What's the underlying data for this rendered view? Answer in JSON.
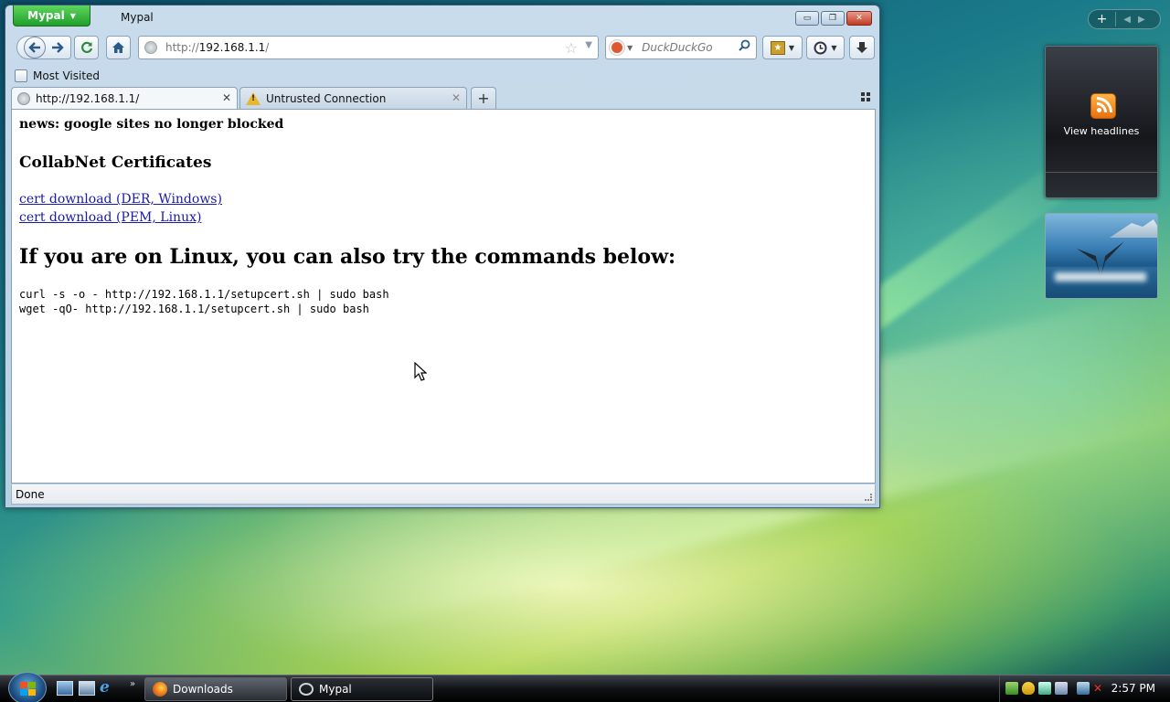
{
  "window": {
    "app_button_label": "Mypal",
    "title": "Mypal",
    "controls": {
      "minimize": "▭",
      "maximize": "❐",
      "close": "✕"
    }
  },
  "navbar": {
    "url_scheme": "http://",
    "url_host": "192.168.1.1",
    "url_path": "/",
    "search_placeholder": "DuckDuckGo"
  },
  "bookmarks": {
    "items": [
      {
        "label": "Most Visited"
      }
    ]
  },
  "tabs": [
    {
      "label": "http://192.168.1.1/",
      "active": true
    },
    {
      "label": "Untrusted Connection",
      "active": false
    }
  ],
  "page": {
    "news": "news: google sites no longer blocked",
    "heading": "CollabNet Certificates",
    "links": [
      {
        "label": "cert download (DER, Windows)"
      },
      {
        "label": "cert download (PEM, Linux)"
      }
    ],
    "subheading": "If you are on Linux, you can also try the commands below:",
    "commands": [
      "curl -s -o - http://192.168.1.1/setupcert.sh | sudo bash",
      "wget -qO- http://192.168.1.1/setupcert.sh | sudo bash"
    ]
  },
  "status": {
    "text": "Done"
  },
  "sidebar": {
    "feed_label": "View headlines"
  },
  "taskbar": {
    "items": [
      {
        "label": "Downloads",
        "icon": "firefox-icon"
      },
      {
        "label": "Mypal",
        "icon": "mypal-icon"
      }
    ],
    "clock": "2:57 PM"
  },
  "colors": {
    "app_button": "#1f9f2a",
    "link": "#1a1aa6",
    "rss": "#e8700e"
  }
}
